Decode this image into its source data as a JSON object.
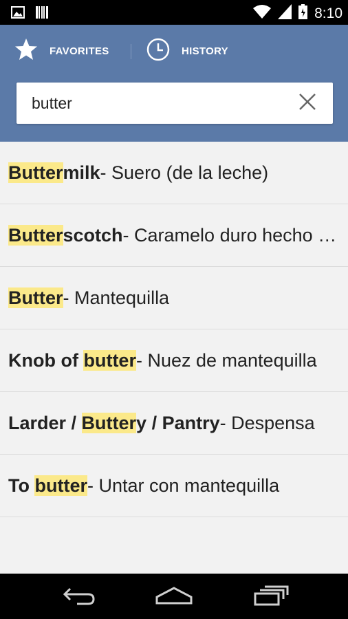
{
  "status_bar": {
    "time": "8:10",
    "left_icons": [
      "image-icon",
      "barcode-icon"
    ],
    "right_icons": [
      "wifi-icon",
      "signal-icon",
      "battery-icon"
    ]
  },
  "tabs": {
    "favorites_label": "FAVORITES",
    "history_label": "HISTORY"
  },
  "search": {
    "value": "butter"
  },
  "results": [
    {
      "term_parts": [
        "Butter",
        "milk"
      ],
      "translation": " - Suero (de la leche)"
    },
    {
      "term_parts": [
        "Butter",
        "scotch"
      ],
      "translation": " - Caramelo duro hecho de mantequilla"
    },
    {
      "term_parts": [
        "Butter",
        ""
      ],
      "translation": " - Mantequilla"
    },
    {
      "term_parts": [
        "Knob of ",
        "butter",
        ""
      ],
      "translation": " - Nuez de mantequilla"
    },
    {
      "term_parts": [
        "Larder / ",
        "Butter",
        "y / Pantry"
      ],
      "translation": " - Despensa"
    },
    {
      "term_parts": [
        "To ",
        "butter",
        ""
      ],
      "translation": " - Untar con mantequilla"
    }
  ],
  "colors": {
    "app_bar": "#5b7aa8",
    "highlight": "#fbe98a",
    "list_bg": "#f2f2f2"
  }
}
